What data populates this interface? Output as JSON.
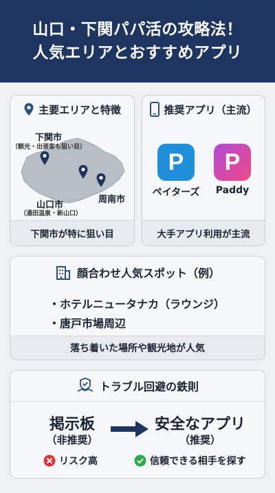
{
  "header": {
    "title_line1": "山口・下関パパ活の攻略法！",
    "title_line2": "人気エリアとおすすめアプリ"
  },
  "areas": {
    "title": "主要エリアと特徴",
    "shimonoseki_name": "下関市",
    "shimonoseki_note": "（観光・出張客も狙い目）",
    "yamaguchi_name": "山口市",
    "yamaguchi_note": "（湯田温泉・新山口）",
    "shunan_name": "周南市",
    "footer": "下関市が特に狙い目"
  },
  "apps": {
    "title": "推奨アプリ（主流）",
    "app1_name": "ペイターズ",
    "app1_color": "#1e8fd8",
    "app2_name": "Paddy",
    "app2_color": "#e0478f",
    "footer": "大手アプリ利用が主流"
  },
  "spots": {
    "title": "顔合わせ人気スポット（例）",
    "items": [
      "・ホテルニュータナカ（ラウンジ）",
      "・唐戸市場周辺"
    ],
    "footer": "落ち着いた場所や観光地が人気"
  },
  "trouble": {
    "title": "トラブル回避の鉄則",
    "left_main": "掲示板",
    "left_sub": "（非推奨）",
    "left_note": "リスク高",
    "right_main": "安全なアプリ",
    "right_sub": "（推奨）",
    "right_note": "信頼できる相手を探す"
  }
}
